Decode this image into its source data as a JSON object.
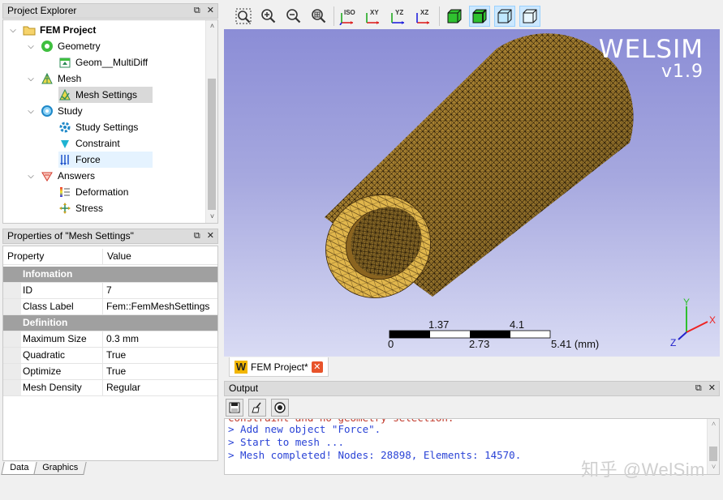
{
  "project_explorer": {
    "title": "Project Explorer",
    "float_icon": "float-icon",
    "close_icon": "close-icon",
    "tree": [
      {
        "label": "FEM Project",
        "icon": "folder-icon"
      },
      {
        "label": "Geometry",
        "icon": "geometry-icon"
      },
      {
        "label": "Geom__MultiDiff",
        "icon": "geom-part-icon"
      },
      {
        "label": "Mesh",
        "icon": "mesh-icon"
      },
      {
        "label": "Mesh Settings",
        "icon": "mesh-settings-icon"
      },
      {
        "label": "Study",
        "icon": "study-icon"
      },
      {
        "label": "Study Settings",
        "icon": "study-settings-icon"
      },
      {
        "label": "Constraint",
        "icon": "constraint-icon"
      },
      {
        "label": "Force",
        "icon": "force-icon"
      },
      {
        "label": "Answers",
        "icon": "answers-icon"
      },
      {
        "label": "Deformation",
        "icon": "deformation-icon"
      },
      {
        "label": "Stress",
        "icon": "stress-icon"
      }
    ]
  },
  "properties": {
    "title": "Properties of \"Mesh Settings\"",
    "col_property": "Property",
    "col_value": "Value",
    "rows": [
      {
        "type": "group",
        "property": "Infomation",
        "value": ""
      },
      {
        "type": "row",
        "property": "ID",
        "value": "7"
      },
      {
        "type": "row",
        "property": "Class Label",
        "value": "Fem::FemMeshSettings"
      },
      {
        "type": "group",
        "property": "Definition",
        "value": ""
      },
      {
        "type": "row",
        "property": "Maximum Size",
        "value": "0.3 mm"
      },
      {
        "type": "row",
        "property": "Quadratic",
        "value": "True"
      },
      {
        "type": "row",
        "property": "Optimize",
        "value": "True"
      },
      {
        "type": "row",
        "property": "Mesh Density",
        "value": "Regular"
      }
    ],
    "bottom_tabs": [
      "Data",
      "Graphics"
    ]
  },
  "toolbar": {
    "buttons": [
      {
        "name": "zoom-fit-icon"
      },
      {
        "name": "zoom-in-icon"
      },
      {
        "name": "zoom-out-icon"
      },
      {
        "name": "zoom-box-icon"
      },
      {
        "name": "view-iso-icon",
        "label": "ISO"
      },
      {
        "name": "view-xy-icon",
        "label": "XY"
      },
      {
        "name": "view-yz-icon",
        "label": "YZ"
      },
      {
        "name": "view-xz-icon",
        "label": "XZ"
      },
      {
        "name": "display-solid-icon"
      },
      {
        "name": "display-solid-edges-icon"
      },
      {
        "name": "display-wireframe-icon"
      },
      {
        "name": "display-transparent-icon"
      }
    ]
  },
  "viewport": {
    "brand": "WELSIM",
    "version": "v1.9",
    "scale_top": [
      "1.37",
      "4.1"
    ],
    "scale_bottom": [
      "0",
      "2.73",
      "5.41 (mm)"
    ],
    "axes": {
      "y": "Y",
      "x": "X",
      "z": "Z"
    },
    "colors": {
      "mesh_face": "#c99b3a",
      "mesh_edge": "#2a1a05",
      "bg_top": "#8b8dd6",
      "bg_bottom": "#d9dbf4"
    }
  },
  "document_tab": {
    "label": "FEM Project*"
  },
  "output": {
    "title": "Output",
    "lines": [
      "> Add new object \"Force\".",
      "> Start to mesh ...",
      "> Mesh completed! Nodes: 28898, Elements: 14570."
    ],
    "clipped_line": "constraint and no geometry selection."
  },
  "watermark": "知乎 @WelSim"
}
